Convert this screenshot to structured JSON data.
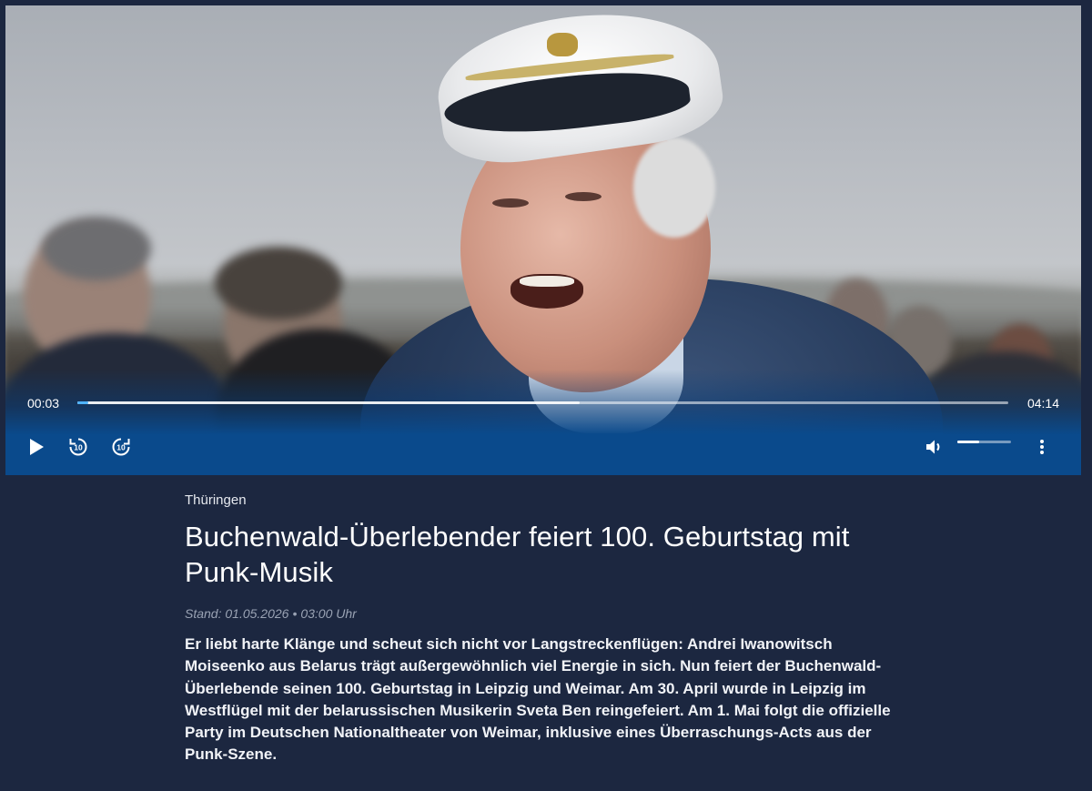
{
  "player": {
    "current_time": "00:03",
    "total_time": "04:14",
    "progress_fraction": 0.012,
    "buffered_fraction": 0.54,
    "volume_fraction": 0.4,
    "accent_color": "#4fb3ff",
    "controls_color": "#0a4a8c",
    "icons": {
      "play": "play-icon",
      "rewind": "rewind-10-icon",
      "forward": "forward-10-icon",
      "volume": "volume-icon",
      "more": "more-vertical-icon"
    },
    "rewind_label": "10",
    "forward_label": "10"
  },
  "article": {
    "kicker": "Thüringen",
    "headline": "Buchenwald-Überlebender feiert 100. Geburtstag mit Punk-Musik",
    "date_prefix": "Stand: 01.05.2026",
    "date_separator": "•",
    "time": "03:00 Uhr",
    "teaser": "Er liebt harte Klänge und scheut sich nicht vor Langstreckenflügen: Andrei Iwanowitsch Moiseenko aus Belarus trägt außergewöhnlich viel Energie in sich. Nun feiert der Buchenwald-Überlebende seinen 100. Geburtstag in Leipzig und Weimar. Am 30. April wurde in Leipzig im Westflügel mit der belarussischen Musikerin Sveta Ben reingefeiert. Am 1. Mai folgt die offizielle Party im Deutschen Nationaltheater von Weimar, inklusive eines Überraschungs-Acts aus der Punk-Szene."
  },
  "colors": {
    "page_background": "#1c2740",
    "date_color": "#9aa3b4"
  }
}
